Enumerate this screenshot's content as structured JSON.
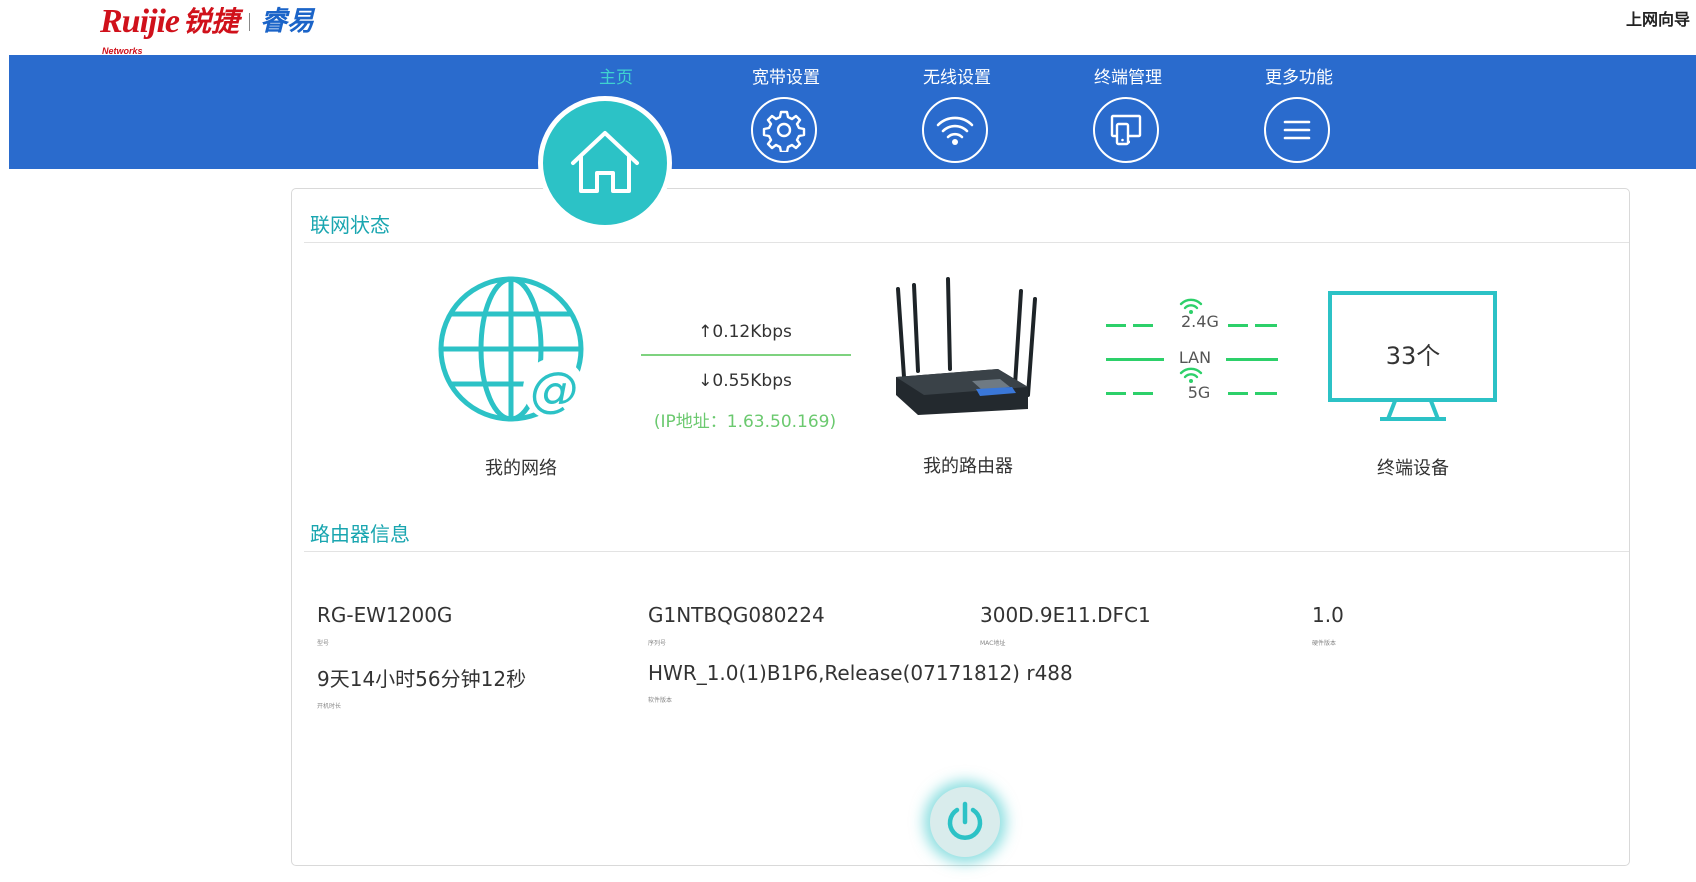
{
  "brand": {
    "ruijie": "Ruijie",
    "networks": "Networks",
    "ruijie_cn": "锐捷",
    "sub": "睿易"
  },
  "header": {
    "wizard_label": "上网向导"
  },
  "nav": {
    "home": "主页",
    "broadband": "宽带设置",
    "wireless": "无线设置",
    "terminal": "终端管理",
    "more": "更多功能"
  },
  "status": {
    "title": "联网状态",
    "my_network": "我的网络",
    "upload": "↑0.12Kbps",
    "download": "↓0.55Kbps",
    "ip": "(IP地址：1.63.50.169)",
    "my_router": "我的路由器",
    "band_24": "2.4G",
    "band_lan": "LAN",
    "band_5": "5G",
    "device_count": "33个",
    "devices_label": "终端设备"
  },
  "router_info": {
    "title": "路由器信息",
    "model": "RG-EW1200G",
    "model_caption": "型号",
    "serial": "G1NTBQG080224",
    "serial_caption": "序列号",
    "mac": "300D.9E11.DFC1",
    "mac_caption": "MAC地址",
    "hw_version": "1.0",
    "hw_caption": "硬件版本",
    "uptime": "9天14小时56分钟12秒",
    "uptime_caption": "开机时长",
    "sw_version": "HWR_1.0(1)B1P6,Release(07171812) r488",
    "sw_caption": "软件版本"
  },
  "colors": {
    "nav_blue": "#2a6bcd",
    "teal": "#2cc2c6",
    "brand_red": "#d0111b",
    "link_green": "#6bc96f"
  },
  "icons": [
    "home-icon",
    "gear-icon",
    "wifi-icon",
    "devices-icon",
    "menu-icon",
    "globe-icon",
    "router-icon",
    "monitor-icon",
    "power-icon"
  ]
}
